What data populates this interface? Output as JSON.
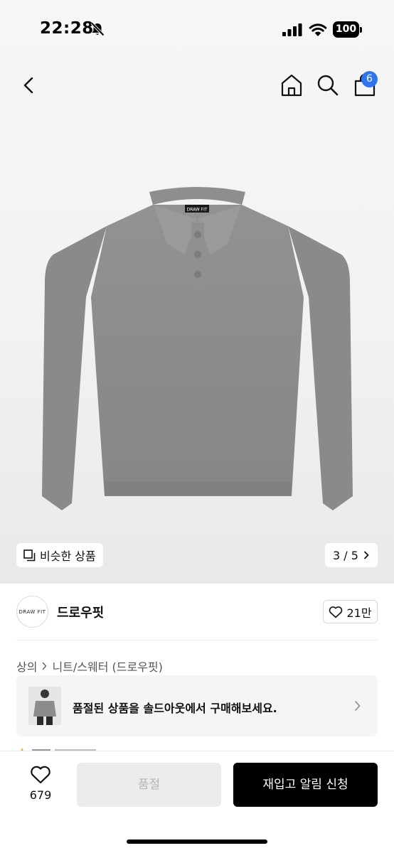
{
  "status_bar": {
    "time": "22:28",
    "battery": "100"
  },
  "nav": {
    "cart_count": "6"
  },
  "gallery": {
    "similar_label": "비슷한 상품",
    "page_indicator": "3 / 5",
    "tag_text": "DRAW FIT"
  },
  "brand": {
    "logo_text": "DRAW FIT",
    "name": "드로우핏",
    "likes": "21만"
  },
  "breadcrumb": {
    "category": "상의",
    "subcategory": "니트/스웨터 (드로우핏)"
  },
  "soldout_banner": {
    "text": "품절된 상품을 솔드아웃에서 구매해보세요."
  },
  "bottom_bar": {
    "wish_count": "679",
    "soldout_label": "품절",
    "restock_label": "재입고 알림 신청"
  },
  "colors": {
    "accent_blue": "#2f74f5",
    "primary_black": "#000000",
    "disabled_bg": "#ececec",
    "sweater_gray": "#8e8e8e"
  }
}
